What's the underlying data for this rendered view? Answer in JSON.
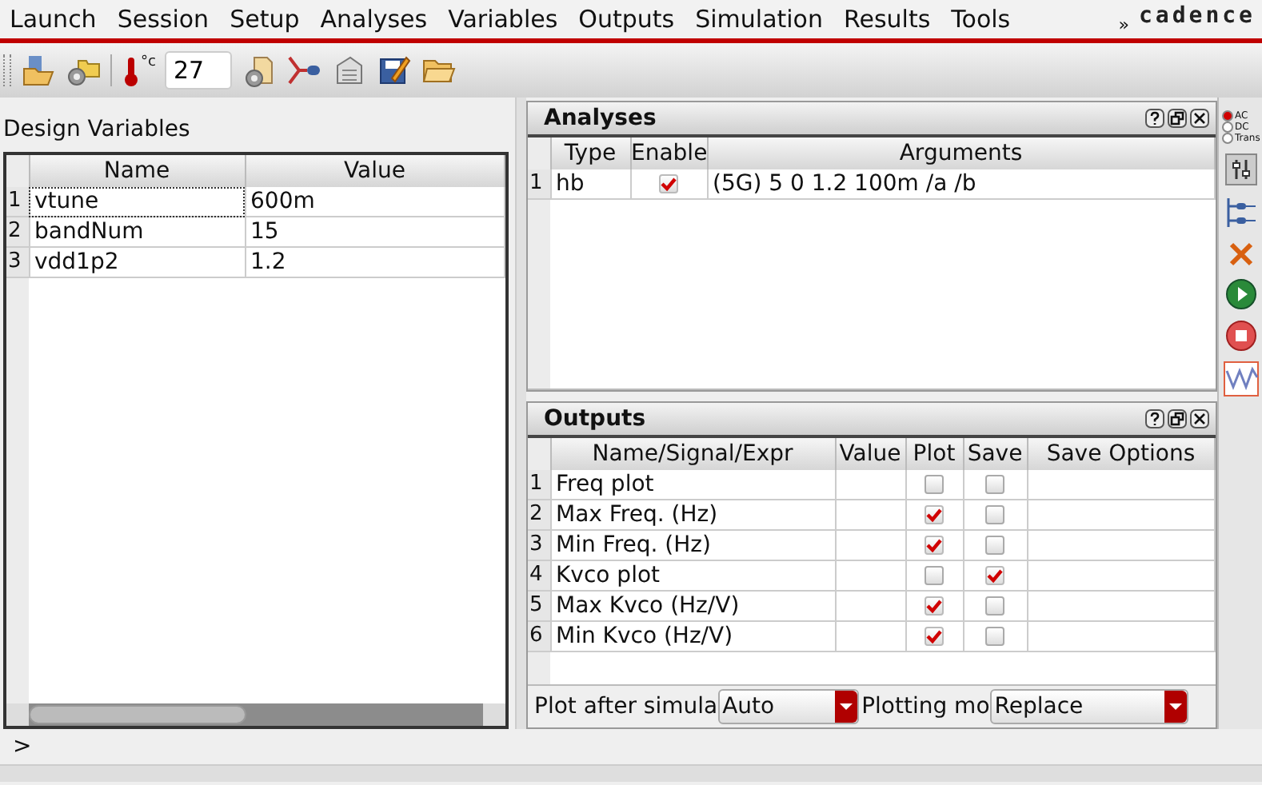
{
  "menu": [
    "Launch",
    "Session",
    "Setup",
    "Analyses",
    "Variables",
    "Outputs",
    "Simulation",
    "Results",
    "Tools"
  ],
  "menu_overflow": "»",
  "logo": "cadence",
  "toolbar": {
    "temperature_unit": "°c",
    "temperature": "27"
  },
  "design_variables": {
    "title": "Design Variables",
    "columns": [
      "Name",
      "Value"
    ],
    "rows": [
      {
        "index": "1",
        "name": "vtune",
        "value": "600m",
        "selected": true
      },
      {
        "index": "2",
        "name": "bandNum",
        "value": "15",
        "selected": false
      },
      {
        "index": "3",
        "name": "vdd1p2",
        "value": "1.2",
        "selected": false
      }
    ]
  },
  "analyses": {
    "title": "Analyses",
    "columns": [
      "Type",
      "Enable",
      "Arguments"
    ],
    "rows": [
      {
        "index": "1",
        "type": "hb",
        "enabled": true,
        "arguments": "(5G) 5 0 1.2 100m /a /b"
      }
    ]
  },
  "outputs": {
    "title": "Outputs",
    "columns": [
      "Name/Signal/Expr",
      "Value",
      "Plot",
      "Save",
      "Save Options"
    ],
    "rows": [
      {
        "index": "1",
        "name": "Freq plot",
        "plot": false,
        "save": false
      },
      {
        "index": "2",
        "name": "Max Freq. (Hz)",
        "plot": true,
        "save": false
      },
      {
        "index": "3",
        "name": "Min Freq. (Hz)",
        "plot": true,
        "save": false
      },
      {
        "index": "4",
        "name": "Kvco plot",
        "plot": false,
        "save": true
      },
      {
        "index": "5",
        "name": "Max Kvco (Hz/V)",
        "plot": true,
        "save": false
      },
      {
        "index": "6",
        "name": "Min Kvco (Hz/V)",
        "plot": true,
        "save": false
      }
    ]
  },
  "plot_options": {
    "plot_after_label": "Plot after simula",
    "plot_after_value": "Auto",
    "plotting_mode_label": "Plotting mo",
    "plotting_mode_value": "Replace"
  },
  "analysis_types": [
    {
      "label": "AC",
      "selected": true
    },
    {
      "label": "DC",
      "selected": false
    },
    {
      "label": "Trans",
      "selected": false
    }
  ],
  "command_prompt": ">"
}
